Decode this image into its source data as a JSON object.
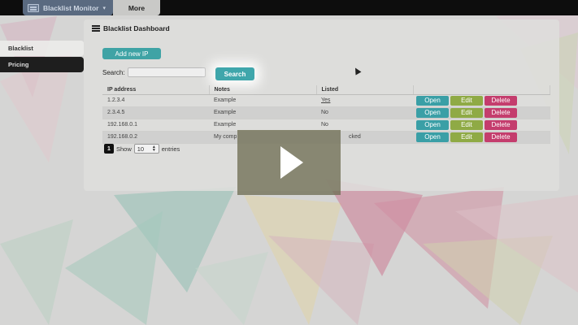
{
  "navbar": {
    "brand": "Blacklist Monitor",
    "more": "More"
  },
  "sidebar": {
    "items": [
      {
        "label": "Blacklist"
      },
      {
        "label": "Pricing"
      }
    ]
  },
  "panel": {
    "title": "Blacklist Dashboard",
    "add_button": "Add new IP",
    "search_label": "Search:",
    "search_placeholder": "",
    "search_button": "Search"
  },
  "table": {
    "headers": [
      "IP address",
      "Notes",
      "Listed"
    ],
    "rows": [
      {
        "ip": "1.2.3.4",
        "notes": "Example",
        "listed": "Yes"
      },
      {
        "ip": "2.3.4.5",
        "notes": "Example",
        "listed": "No"
      },
      {
        "ip": "192.168.0.1",
        "notes": "Example",
        "listed": "No"
      },
      {
        "ip": "192.168.0.2",
        "notes": "My comp",
        "listed": "cked"
      }
    ],
    "actions": {
      "open": "Open",
      "edit": "Edit",
      "delete": "Delete"
    }
  },
  "pagination": {
    "page": "1",
    "show_label": "Show",
    "entries_value": "10",
    "entries_label": "entries"
  },
  "colors": {
    "open": "#3a9fa6",
    "edit": "#8faa45",
    "delete": "#c43d6d",
    "accent": "#3fa3a5"
  }
}
